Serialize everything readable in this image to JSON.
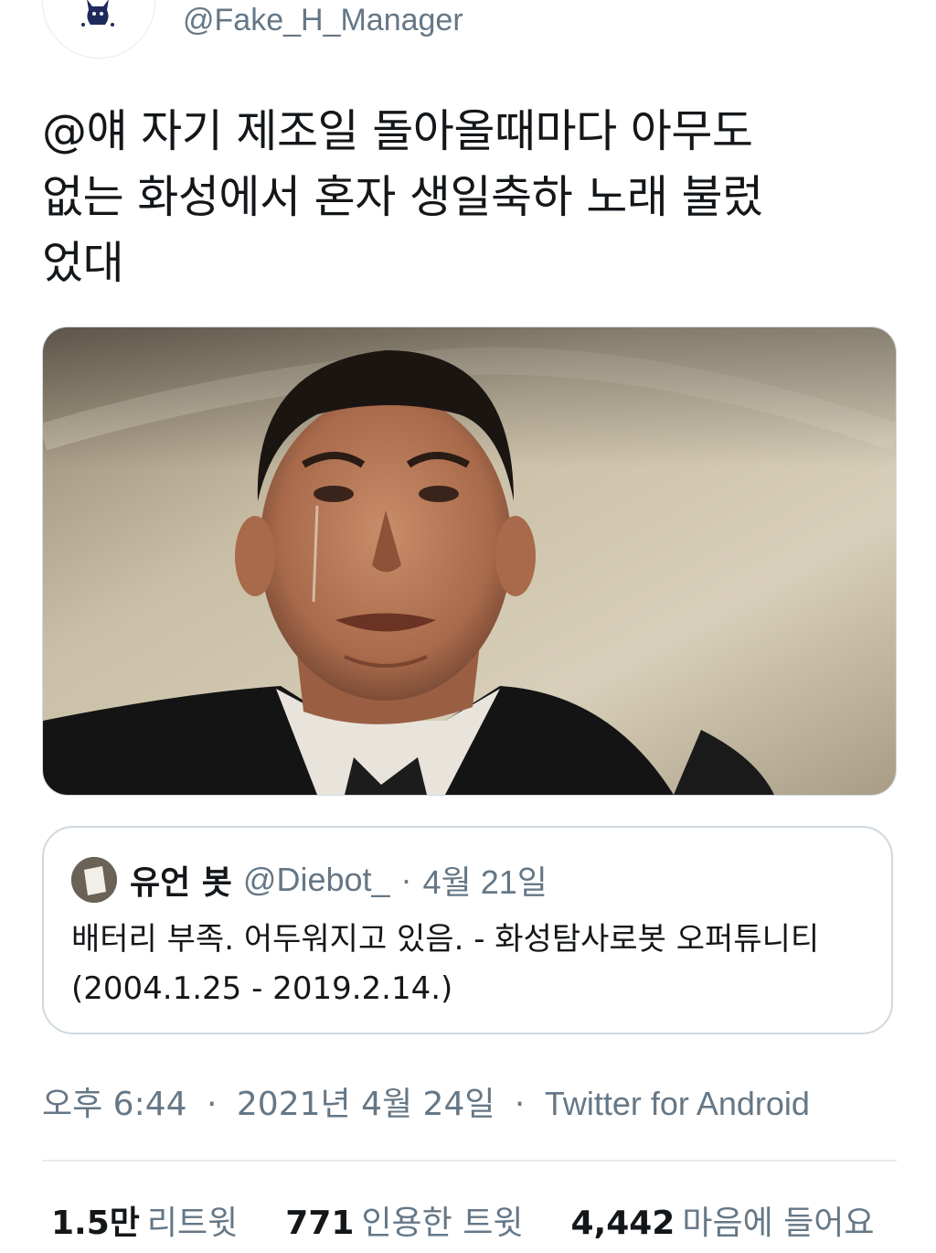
{
  "author": {
    "handle": "@Fake_H_Manager"
  },
  "tweet": {
    "text": "@얘 자기 제조일 돌아올때마다 아무도\n없는 화성에서 혼자 생일축하 노래 불렀\n었대"
  },
  "quote": {
    "name": "유언 봇",
    "handle": "@Diebot_",
    "separator": "·",
    "date": "4월 21일",
    "text": "배터리 부족. 어두워지고 있음. - 화성탐사로봇 오퍼튜니티\n(2004.1.25 - 2019.2.14.)"
  },
  "meta": {
    "time": "오후 6:44",
    "sep1": "·",
    "date": "2021년 4월 24일",
    "sep2": "·",
    "source": "Twitter for Android"
  },
  "stats": {
    "retweets_count": "1.5만",
    "retweets_label": "리트윗",
    "quotes_count": "771",
    "quotes_label": "인용한 트윗",
    "likes_count": "4,442",
    "likes_label": "마음에 들어요"
  },
  "colors": {
    "text_primary": "#14171a",
    "text_secondary": "#657786",
    "border": "#cfd9de"
  }
}
